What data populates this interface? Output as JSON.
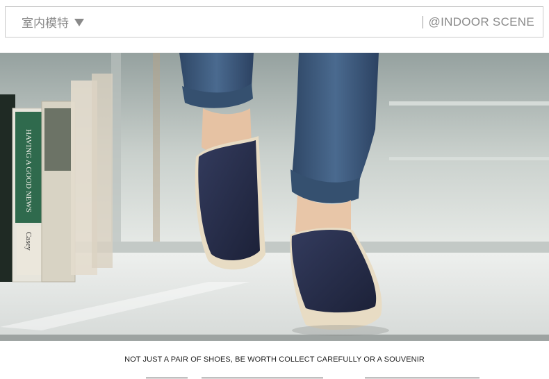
{
  "header": {
    "left_label": "室内模特",
    "left_icon": "triangle-down-icon",
    "right_label": "@INDOOR SCENE"
  },
  "photo": {
    "book_labels": [
      "HAVING A GOOD NEWS",
      "Casey"
    ]
  },
  "caption": "NOT JUST A PAIR OF SHOES, BE WORTH COLLECT CAREFULLY OR A SOUVENIR",
  "colors": {
    "text_gray": "#8a8a8a",
    "shoe_navy": "#252c4a",
    "sole_beige": "#e8dcc4",
    "denim": "#3f5a7c"
  }
}
